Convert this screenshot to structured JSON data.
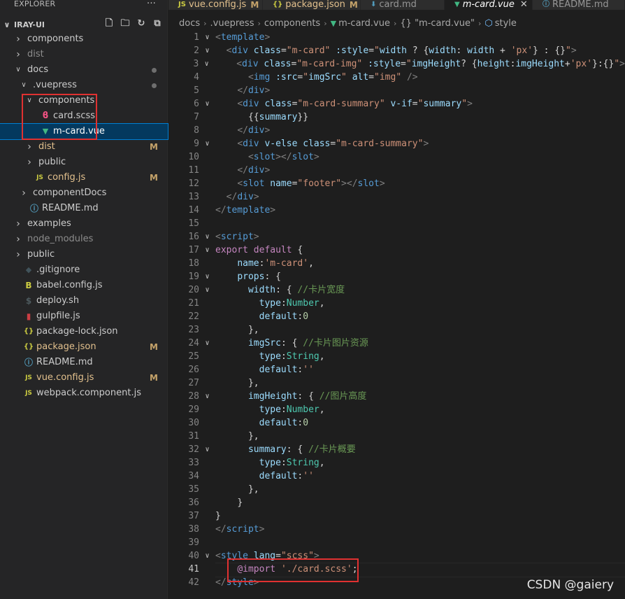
{
  "sidebar": {
    "title": "EXPLORER",
    "more": "···",
    "root": "IRAY-UI",
    "items": [
      {
        "name": "components",
        "type": "folder",
        "open": false,
        "indent": 0
      },
      {
        "name": "dist",
        "type": "folder",
        "open": false,
        "indent": 0,
        "dim": true
      },
      {
        "name": "docs",
        "type": "folder",
        "open": true,
        "indent": 0,
        "dot": true
      },
      {
        "name": ".vuepress",
        "type": "folder",
        "open": true,
        "indent": 1,
        "dot": true
      },
      {
        "name": "components",
        "type": "folder",
        "open": true,
        "indent": 2
      },
      {
        "name": "card.scss",
        "type": "scss",
        "indent": 3
      },
      {
        "name": "m-card.vue",
        "type": "vue",
        "indent": 3,
        "selected": true
      },
      {
        "name": "dist",
        "type": "folder",
        "open": false,
        "indent": 2,
        "badge": "M",
        "modified": true
      },
      {
        "name": "public",
        "type": "folder",
        "open": false,
        "indent": 2
      },
      {
        "name": "config.js",
        "type": "js",
        "indent": 2,
        "badge": "M",
        "modified": true
      },
      {
        "name": "componentDocs",
        "type": "folder",
        "open": false,
        "indent": 1
      },
      {
        "name": "README.md",
        "type": "info",
        "indent": 1
      },
      {
        "name": "examples",
        "type": "folder",
        "open": false,
        "indent": 0
      },
      {
        "name": "node_modules",
        "type": "folder",
        "open": false,
        "indent": 0,
        "dim": true
      },
      {
        "name": "public",
        "type": "folder",
        "open": false,
        "indent": 0
      },
      {
        "name": ".gitignore",
        "type": "git",
        "indent": 0
      },
      {
        "name": "babel.config.js",
        "type": "babel",
        "indent": 0
      },
      {
        "name": "deploy.sh",
        "type": "sh",
        "indent": 0
      },
      {
        "name": "gulpfile.js",
        "type": "gulp",
        "indent": 0
      },
      {
        "name": "package-lock.json",
        "type": "json",
        "indent": 0
      },
      {
        "name": "package.json",
        "type": "json",
        "indent": 0,
        "badge": "M",
        "modified": true
      },
      {
        "name": "README.md",
        "type": "info",
        "indent": 0
      },
      {
        "name": "vue.config.js",
        "type": "js",
        "indent": 0,
        "badge": "M",
        "modified": true
      },
      {
        "name": "webpack.component.js",
        "type": "js",
        "indent": 0
      }
    ]
  },
  "tabs": [
    {
      "label": "vue.config.js",
      "icon": "JS",
      "icon_color": "#cbcb41",
      "badge": "M",
      "width": 135
    },
    {
      "label": "package.json",
      "icon": "{}",
      "icon_color": "#cbcb41",
      "badge": "M",
      "width": 140
    },
    {
      "label": "card.md",
      "icon": "⬇",
      "icon_color": "#519aba",
      "badge": "",
      "width": 120
    },
    {
      "label": "m-card.vue",
      "icon": "▼",
      "icon_color": "#41b883",
      "badge": "",
      "active": true,
      "close": "✕",
      "width": 126
    },
    {
      "label": "README.md",
      "icon": "ⓘ",
      "icon_color": "#519aba",
      "badge": "",
      "width": 132
    }
  ],
  "breadcrumb": {
    "parts": [
      "docs",
      ".vuepress",
      "components",
      "m-card.vue",
      "{} \"m-card.vue\"",
      "style"
    ]
  },
  "watermark": "CSDN @gaiery",
  "code_lines": [
    {
      "n": "1",
      "fold": "∨",
      "html": "<span class='p'>&lt;</span><span class='t'>template</span><span class='p'>&gt;</span>"
    },
    {
      "n": "2",
      "fold": "∨",
      "html": "  <span class='p'>&lt;</span><span class='t'>div</span> <span class='a'>class</span><span class='d'>=</span><span class='s'>\"m-card\"</span> <span class='a'>:style</span><span class='d'>=</span><span class='s'>\"</span><span class='a'>width</span><span class='d'> ? {</span><span class='a'>width</span><span class='d'>: </span><span class='a'>width</span><span class='d'> + </span><span class='s'>'px'</span><span class='d'>} : {}</span><span class='s'>\"</span><span class='p'>&gt;</span>"
    },
    {
      "n": "3",
      "fold": "∨",
      "html": "    <span class='p'>&lt;</span><span class='t'>div</span> <span class='a'>class</span><span class='d'>=</span><span class='s'>\"m-card-img\"</span> <span class='a'>:style</span><span class='d'>=</span><span class='s'>\"</span><span class='a'>imgHeight</span><span class='d'>? {</span><span class='a'>height</span><span class='d'>:</span><span class='a'>imgHeight</span><span class='d'>+</span><span class='s'>'px'</span><span class='d'>}:{}</span><span class='s'>\"</span><span class='p'>&gt;</span>"
    },
    {
      "n": "4",
      "fold": "",
      "html": "      <span class='p'>&lt;</span><span class='t'>img</span> <span class='a'>:src</span><span class='d'>=</span><span class='s'>\"</span><span class='a'>imgSrc</span><span class='s'>\"</span> <span class='a'>alt</span><span class='d'>=</span><span class='s'>\"img\"</span> <span class='p'>/&gt;</span>"
    },
    {
      "n": "5",
      "fold": "",
      "html": "    <span class='p'>&lt;/</span><span class='t'>div</span><span class='p'>&gt;</span>"
    },
    {
      "n": "6",
      "fold": "∨",
      "html": "    <span class='p'>&lt;</span><span class='t'>div</span> <span class='a'>class</span><span class='d'>=</span><span class='s'>\"m-card-summary\"</span> <span class='a'>v-if</span><span class='d'>=</span><span class='s'>\"</span><span class='a'>summary</span><span class='s'>\"</span><span class='p'>&gt;</span>"
    },
    {
      "n": "7",
      "fold": "",
      "html": "      <span class='d'>{{</span><span class='a'>summary</span><span class='d'>}}</span>"
    },
    {
      "n": "8",
      "fold": "",
      "html": "    <span class='p'>&lt;/</span><span class='t'>div</span><span class='p'>&gt;</span>"
    },
    {
      "n": "9",
      "fold": "∨",
      "html": "    <span class='p'>&lt;</span><span class='t'>div</span> <span class='a'>v-else</span> <span class='a'>class</span><span class='d'>=</span><span class='s'>\"m-card-summary\"</span><span class='p'>&gt;</span>"
    },
    {
      "n": "10",
      "fold": "",
      "html": "      <span class='p'>&lt;</span><span class='t'>slot</span><span class='p'>&gt;&lt;/</span><span class='t'>slot</span><span class='p'>&gt;</span>"
    },
    {
      "n": "11",
      "fold": "",
      "html": "    <span class='p'>&lt;/</span><span class='t'>div</span><span class='p'>&gt;</span>"
    },
    {
      "n": "12",
      "fold": "",
      "html": "    <span class='p'>&lt;</span><span class='t'>slot</span> <span class='a'>name</span><span class='d'>=</span><span class='s'>\"footer\"</span><span class='p'>&gt;&lt;/</span><span class='t'>slot</span><span class='p'>&gt;</span>"
    },
    {
      "n": "13",
      "fold": "",
      "html": "  <span class='p'>&lt;/</span><span class='t'>div</span><span class='p'>&gt;</span>"
    },
    {
      "n": "14",
      "fold": "",
      "html": "<span class='p'>&lt;/</span><span class='t'>template</span><span class='p'>&gt;</span>"
    },
    {
      "n": "15",
      "fold": "",
      "html": ""
    },
    {
      "n": "16",
      "fold": "∨",
      "html": "<span class='p'>&lt;</span><span class='t'>script</span><span class='p'>&gt;</span>"
    },
    {
      "n": "17",
      "fold": "∨",
      "html": "<span class='k'>export</span> <span class='k'>default</span> <span class='d'>{</span>"
    },
    {
      "n": "18",
      "fold": "",
      "html": "    <span class='a'>name</span><span class='d'>:</span><span class='s'>'m-card'</span><span class='d'>,</span>"
    },
    {
      "n": "19",
      "fold": "∨",
      "html": "    <span class='a'>props</span><span class='d'>: {</span>"
    },
    {
      "n": "20",
      "fold": "∨",
      "html": "      <span class='a'>width</span><span class='d'>: { </span><span class='c'>//卡片宽度</span>"
    },
    {
      "n": "21",
      "fold": "",
      "html": "        <span class='a'>type</span><span class='d'>:</span><span class='y'>Number</span><span class='d'>,</span>"
    },
    {
      "n": "22",
      "fold": "",
      "html": "        <span class='a'>default</span><span class='d'>:</span><span class='n'>0</span>"
    },
    {
      "n": "23",
      "fold": "",
      "html": "      <span class='d'>},</span>"
    },
    {
      "n": "24",
      "fold": "∨",
      "html": "      <span class='a'>imgSrc</span><span class='d'>: { </span><span class='c'>//卡片图片资源</span>"
    },
    {
      "n": "25",
      "fold": "",
      "html": "        <span class='a'>type</span><span class='d'>:</span><span class='y'>String</span><span class='d'>,</span>"
    },
    {
      "n": "26",
      "fold": "",
      "html": "        <span class='a'>default</span><span class='d'>:</span><span class='s'>''</span>"
    },
    {
      "n": "27",
      "fold": "",
      "html": "      <span class='d'>},</span>"
    },
    {
      "n": "28",
      "fold": "∨",
      "html": "      <span class='a'>imgHeight</span><span class='d'>: { </span><span class='c'>//图片高度</span>"
    },
    {
      "n": "29",
      "fold": "",
      "html": "        <span class='a'>type</span><span class='d'>:</span><span class='y'>Number</span><span class='d'>,</span>"
    },
    {
      "n": "30",
      "fold": "",
      "html": "        <span class='a'>default</span><span class='d'>:</span><span class='n'>0</span>"
    },
    {
      "n": "31",
      "fold": "",
      "html": "      <span class='d'>},</span>"
    },
    {
      "n": "32",
      "fold": "∨",
      "html": "      <span class='a'>summary</span><span class='d'>: { </span><span class='c'>//卡片概要</span>"
    },
    {
      "n": "33",
      "fold": "",
      "html": "        <span class='a'>type</span><span class='d'>:</span><span class='y'>String</span><span class='d'>,</span>"
    },
    {
      "n": "34",
      "fold": "",
      "html": "        <span class='a'>default</span><span class='d'>:</span><span class='s'>''</span>"
    },
    {
      "n": "35",
      "fold": "",
      "html": "      <span class='d'>},</span>"
    },
    {
      "n": "36",
      "fold": "",
      "html": "    <span class='d'>}</span>"
    },
    {
      "n": "37",
      "fold": "",
      "html": "<span class='d'>}</span>"
    },
    {
      "n": "38",
      "fold": "",
      "html": "<span class='p'>&lt;/</span><span class='t'>script</span><span class='p'>&gt;</span>"
    },
    {
      "n": "39",
      "fold": "",
      "html": ""
    },
    {
      "n": "40",
      "fold": "∨",
      "html": "<span class='p'>&lt;</span><span class='t'>style</span> <span class='a'>lang</span><span class='d'>=</span><span class='s'>\"scss\"</span><span class='p'>&gt;</span>"
    },
    {
      "n": "41",
      "fold": "",
      "current": true,
      "html": "    <span class='k'>@import</span> <span class='s'>'./card.scss'</span><span class='d'>;</span>"
    },
    {
      "n": "42",
      "fold": "",
      "html": "<span class='p'>&lt;/</span><span class='t'>style</span><span class='p'>&gt;</span>"
    }
  ]
}
